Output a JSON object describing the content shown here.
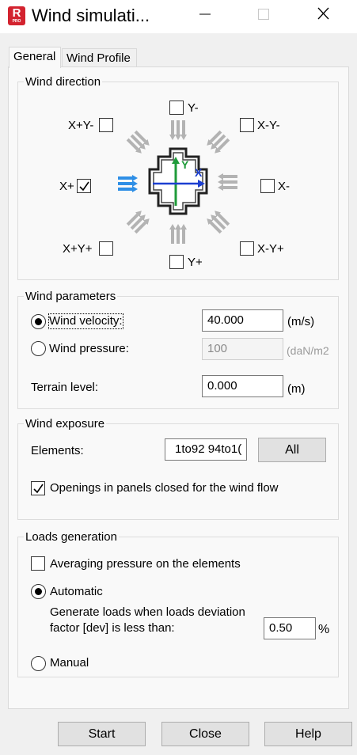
{
  "window": {
    "title": "Wind simulati...",
    "icon_letter": "R",
    "icon_sub": "PRO"
  },
  "tabs": [
    {
      "label": "General",
      "active": true
    },
    {
      "label": "Wind Profile",
      "active": false
    }
  ],
  "wind_direction": {
    "title": "Wind direction",
    "options": {
      "y_minus": {
        "label": "Y-",
        "checked": false
      },
      "xp_ym": {
        "label": "X+Y-",
        "checked": false
      },
      "xm_ym": {
        "label": "X-Y-",
        "checked": false
      },
      "x_plus": {
        "label": "X+",
        "checked": true
      },
      "x_minus": {
        "label": "X-",
        "checked": false
      },
      "xp_yp": {
        "label": "X+Y+",
        "checked": false
      },
      "xm_yp": {
        "label": "X-Y+",
        "checked": false
      },
      "y_plus": {
        "label": "Y+",
        "checked": false
      }
    },
    "diagram": {
      "y_axis": "Y",
      "x_axis": "X",
      "active_color": "#2f8fe6",
      "inactive_color": "#b3b3b3"
    }
  },
  "wind_parameters": {
    "title": "Wind parameters",
    "velocity": {
      "label": "Wind velocity:",
      "value": "40.000",
      "unit": "(m/s)",
      "selected": true
    },
    "pressure": {
      "label": "Wind pressure:",
      "value": "100",
      "unit": "(daN/m2",
      "selected": false
    },
    "terrain": {
      "label": "Terrain level:",
      "value": "0.000",
      "unit": "(m)"
    }
  },
  "wind_exposure": {
    "title": "Wind exposure",
    "elements_label": "Elements:",
    "elements_value": "1to92 94to1(",
    "all_button": "All",
    "openings_label": "Openings in panels closed for the wind flow",
    "openings_checked": true
  },
  "loads_generation": {
    "title": "Loads generation",
    "averaging_label": "Averaging pressure on the elements",
    "averaging_checked": false,
    "automatic_label": "Automatic",
    "automatic_selected": true,
    "generate_line1": "Generate loads when loads deviation",
    "generate_line2": "factor [dev] is less than:",
    "dev_value": "0.50",
    "dev_unit": "%",
    "manual_label": "Manual",
    "manual_selected": false
  },
  "footer": {
    "start": "Start",
    "close": "Close",
    "help": "Help"
  }
}
